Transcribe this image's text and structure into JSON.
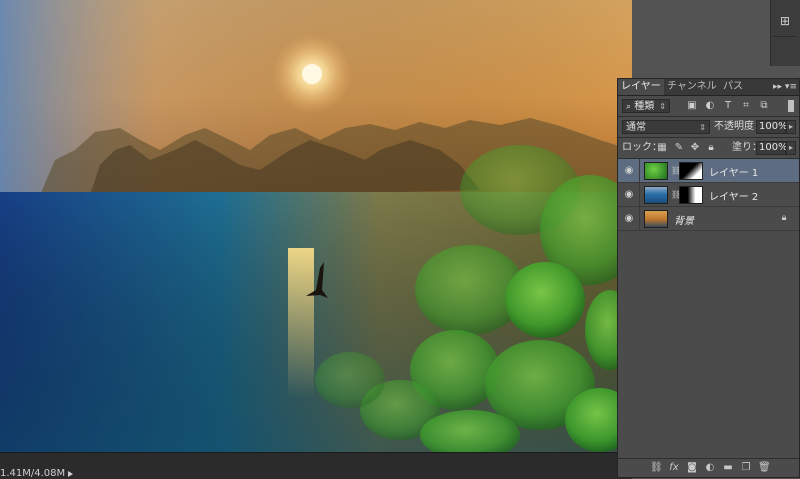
{
  "status": {
    "doc_size": "1.41M/4.08M"
  },
  "panel": {
    "tabs": [
      "レイヤー",
      "チャンネル",
      "パス"
    ],
    "menu_icon": "panel-menu-icon",
    "filter_kind": "種類",
    "blend_mode": "通常",
    "opacity_label": "不透明度：",
    "opacity_value": "100%",
    "lock_label": "ロック：",
    "fill_label": "塗り：",
    "fill_value": "100%"
  },
  "layers": [
    {
      "name": "レイヤー 1",
      "selected": true,
      "has_mask": true
    },
    {
      "name": "レイヤー 2",
      "selected": false,
      "has_mask": true
    },
    {
      "name": "背景",
      "selected": false,
      "has_mask": false,
      "locked": true
    }
  ],
  "icons": {
    "eye": "eye-icon",
    "link": "chain-link-icon",
    "lock": "lock-icon",
    "footer": [
      "link-layers-icon",
      "fx-icon",
      "add-mask-icon",
      "adjustment-icon",
      "folder-icon",
      "new-layer-icon",
      "trash-icon"
    ]
  },
  "colors": {
    "selected_row": "#5d6c80",
    "panel_bg": "#4b4b4b"
  }
}
